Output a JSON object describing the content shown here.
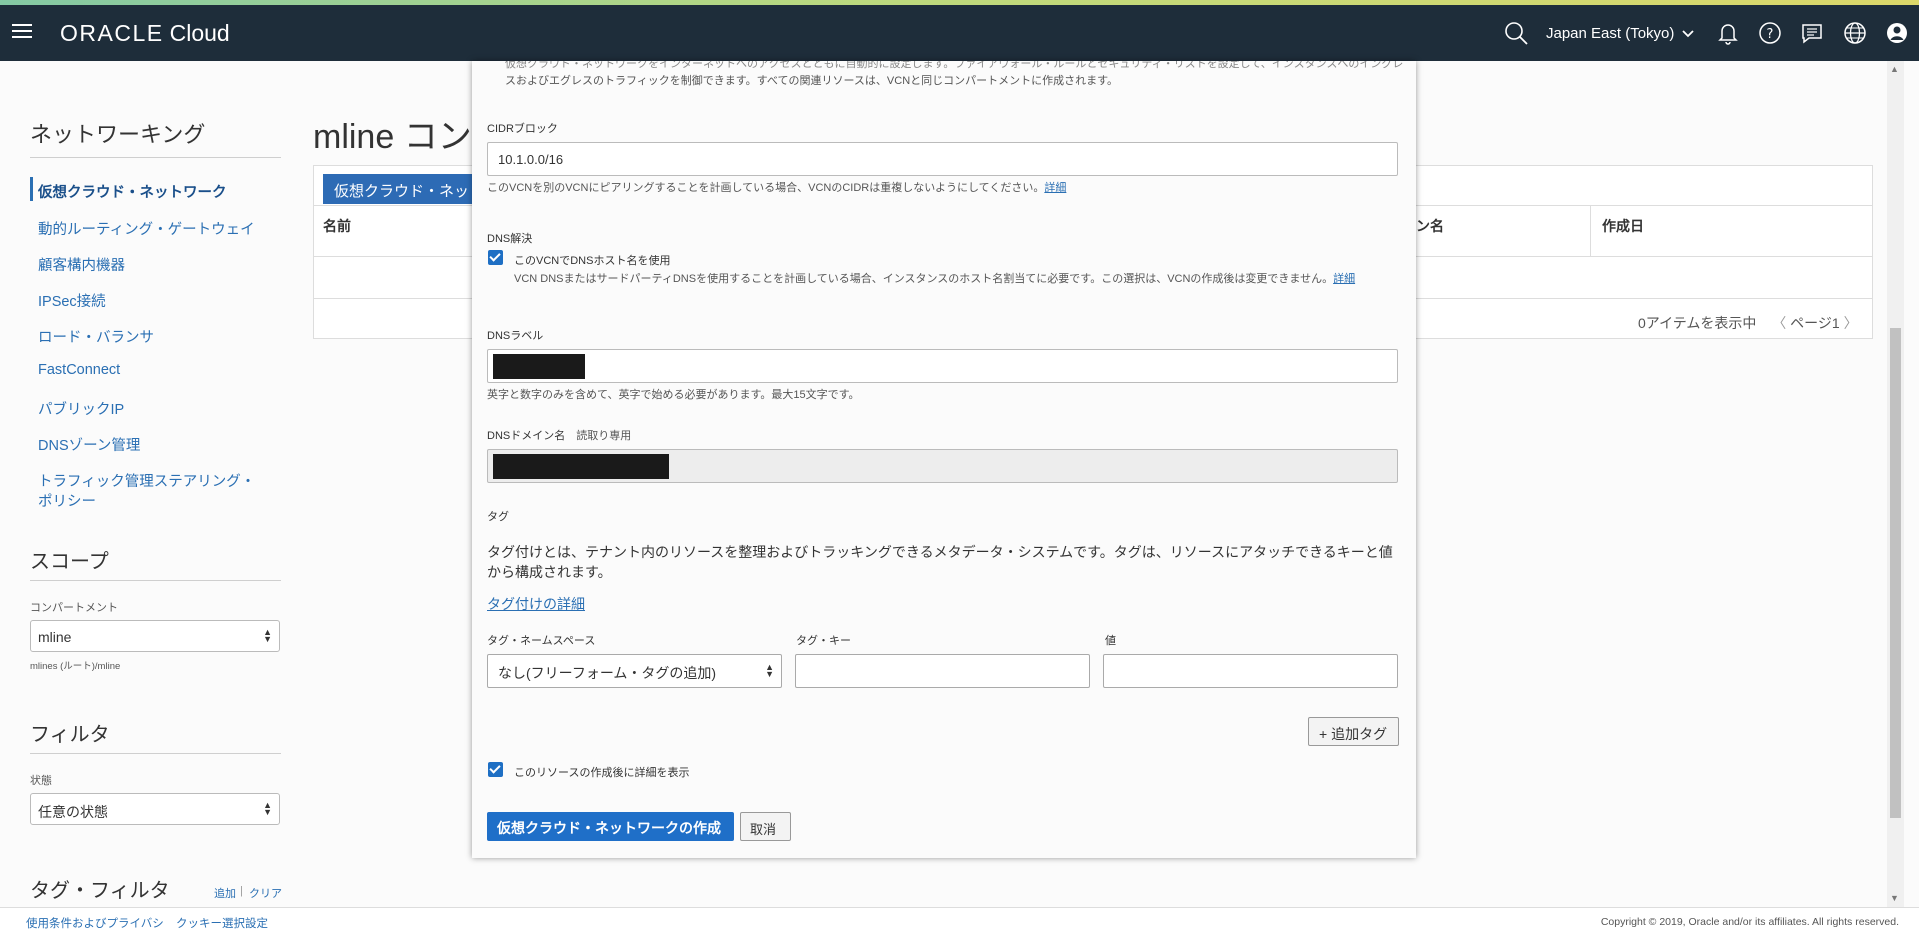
{
  "header": {
    "brand_oracle": "ORACLE",
    "brand_cloud": "Cloud",
    "region": "Japan East (Tokyo)",
    "icons": [
      "menu-icon",
      "search-icon",
      "chevron-down-icon",
      "bell-icon",
      "help-icon",
      "chat-icon",
      "globe-icon",
      "user-icon"
    ]
  },
  "sidebar": {
    "heading": "ネットワーキング",
    "items": [
      {
        "label": "仮想クラウド・ネットワーク",
        "active": true
      },
      {
        "label": "動的ルーティング・ゲートウェイ"
      },
      {
        "label": "顧客構内機器"
      },
      {
        "label": "IPSec接続"
      },
      {
        "label": "ロード・バランサ"
      },
      {
        "label": "FastConnect"
      },
      {
        "label": "パブリックIP"
      },
      {
        "label": "DNSゾーン管理"
      },
      {
        "label": "トラフィック管理ステアリング・"
      },
      {
        "label": "ポリシー"
      }
    ],
    "scope_heading": "スコープ",
    "compartment_label": "コンパートメント",
    "compartment_value": "mline",
    "compartment_path": "mlines (ルート)/mline",
    "filter_heading": "フィルタ",
    "state_label": "状態",
    "state_value": "任意の状態",
    "tag_filter_heading": "タグ・フィルタ",
    "tag_add": "追加",
    "tag_sep": "|",
    "tag_clear": "クリア"
  },
  "main": {
    "title": "mline コン",
    "create_button": "仮想クラウド・ネット",
    "col_name": "名前",
    "col_domain": "ン名",
    "col_created": "作成日",
    "items_count": "0アイテムを表示中",
    "pagination": "ページ1",
    "prev_icon": "chevron-left-icon",
    "next_icon": "chevron-right-icon"
  },
  "modal": {
    "intro_line1": "仮想クラウド・ネットワークをインターネットへのアクセスとともに自動的に設定します。ファイアウォール・ルールとセキュリティ・リストを設定して、インスタンスへのイングレ",
    "intro_line2": "スおよびエグレスのトラフィックを制御できます。すべての関連リソースは、VCNと同じコンパートメントに作成されます。",
    "cidr_label": "CIDRブロック",
    "cidr_value": "10.1.0.0/16",
    "cidr_help": "このVCNを別のVCNにピアリングすることを計画している場合、VCNのCIDRは重複しないようにしてください。",
    "cidr_help_link": "詳細",
    "dns_resolution_label": "DNS解決",
    "dns_checkbox_label": "このVCNでDNSホスト名を使用",
    "dns_checkbox_help": "VCN DNSまたはサードパーティDNSを使用することを計画している場合、インスタンスのホスト名割当てに必要です。この選択は、VCNの作成後は変更できません。",
    "dns_checkbox_help_link": "詳細",
    "dns_label_label": "DNSラベル",
    "dns_label_help": "英字と数字のみを含めて、英字で始める必要があります。最大15文字です。",
    "dns_domain_label": "DNSドメイン名",
    "dns_domain_readonly": "読取り専用",
    "tags_heading": "タグ",
    "tags_desc_line1": "タグ付けとは、テナント内のリソースを整理およびトラッキングできるメタデータ・システムです。タグは、リソースにアタッチできるキーと値",
    "tags_desc_line2": "から構成されます。",
    "tags_link": "タグ付けの詳細",
    "tag_namespace_label": "タグ・ネームスペース",
    "tag_namespace_value": "なし(フリーフォーム・タグの追加)",
    "tag_key_label": "タグ・キー",
    "tag_value_label": "値",
    "add_tag_button": "+ 追加タグ",
    "show_details_label": "このリソースの作成後に詳細を表示",
    "create_button": "仮想クラウド・ネットワークの作成",
    "cancel_button": "取消"
  },
  "footer": {
    "terms": "使用条件およびプライバシ",
    "cookies": "クッキー選択設定",
    "copyright": "Copyright © 2019, Oracle and/or its affiliates. All rights reserved."
  }
}
